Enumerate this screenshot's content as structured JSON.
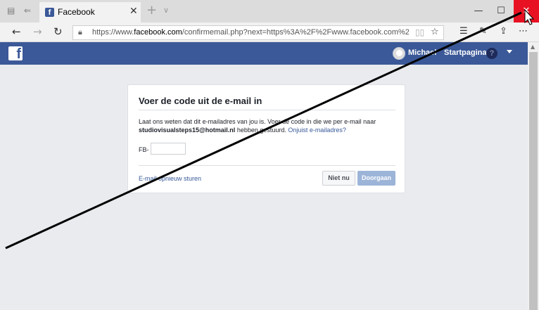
{
  "browser": {
    "tab_title": "Facebook",
    "tab_favicon_letter": "f",
    "url_prefix": "https://www.",
    "url_domain": "facebook.com",
    "url_rest": "/confirmemail.php?next=https%3A%2F%2Fwww.facebook.com%2F&rd&__req=j",
    "icons": {
      "tab_aside": "tab-aside-icon",
      "tab_preview": "tab-preview-icon",
      "new_tab": "plus-icon",
      "tab_list": "chevron-down-icon",
      "back": "arrow-left-icon",
      "forward": "arrow-right-icon",
      "refresh": "refresh-icon",
      "lock": "lock-icon",
      "reading_view": "book-icon",
      "favorite": "star-icon",
      "favorites_hub": "favorites-hub-icon",
      "notes": "pen-icon",
      "share": "share-icon",
      "more": "ellipsis-icon",
      "minimize": "minimize-icon",
      "maximize": "maximize-icon",
      "close": "close-icon"
    }
  },
  "facebook": {
    "logo_letter": "f",
    "user_name": "Michael",
    "home_label": "Startpagina",
    "help_label": "?",
    "brand_color": "#3b5998"
  },
  "dialog": {
    "title": "Voer de code uit de e-mail in",
    "message_part1": "Laat ons weten dat dit e-mailadres van jou is. Voer de code in die we per e-mail naar ",
    "email": "studiovisualsteps15@hotmail.nl",
    "message_part2": " hebben gestuurd. ",
    "wrong_email_link": "Onjuist e-mailadres?",
    "code_prefix": "FB-",
    "code_value": "",
    "resend_link": "E-mail opnieuw sturen",
    "later_button": "Niet nu",
    "continue_button": "Doorgaan"
  },
  "colors": {
    "accent": "#3b5998",
    "link": "#365899",
    "close_red": "#e81123",
    "continue_disabled": "#9cb4d8"
  }
}
